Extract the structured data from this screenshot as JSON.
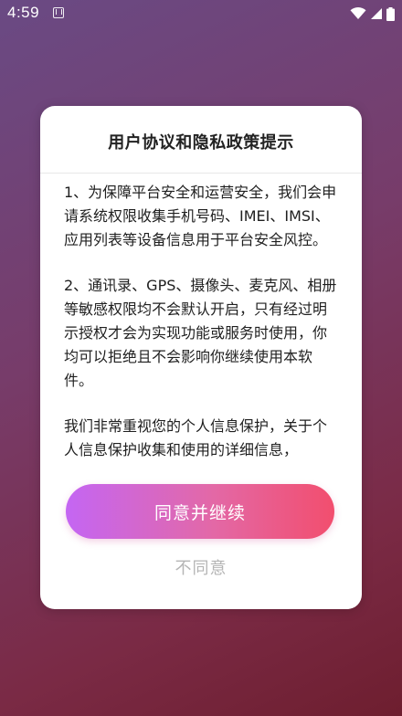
{
  "status_bar": {
    "time": "4:59",
    "icons": [
      "notification-icon",
      "wifi-icon",
      "signal-icon",
      "battery-icon"
    ]
  },
  "dialog": {
    "title": "用户协议和隐私政策提示",
    "paragraphs": [
      "1、为保障平台安全和运营安全，我们会申请系统权限收集手机号码、IMEI、IMSI、应用列表等设备信息用于平台安全风控。",
      "2、通讯录、GPS、摄像头、麦克风、相册等敏感权限均不会默认开启，只有经过明示授权才会为实现功能或服务时使用，你均可以拒绝且不会影响你继续使用本软件。",
      "我们非常重视您的个人信息保护，关于个人信息保护收集和使用的详细信息，"
    ],
    "agree_label": "同意并继续",
    "disagree_label": "不同意"
  },
  "colors": {
    "button_gradient_start": "#c466f3",
    "button_gradient_end": "#f24e6e",
    "disagree_text": "#b5b5b5"
  }
}
